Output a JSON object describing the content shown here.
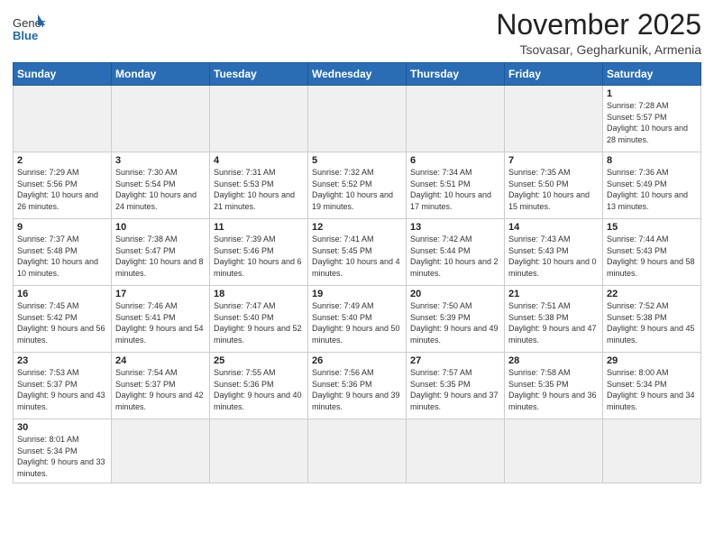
{
  "logo": {
    "general": "General",
    "blue": "Blue"
  },
  "header": {
    "month": "November 2025",
    "location": "Tsovasar, Gegharkunik, Armenia"
  },
  "weekdays": [
    "Sunday",
    "Monday",
    "Tuesday",
    "Wednesday",
    "Thursday",
    "Friday",
    "Saturday"
  ],
  "weeks": [
    [
      {
        "day": "",
        "info": ""
      },
      {
        "day": "",
        "info": ""
      },
      {
        "day": "",
        "info": ""
      },
      {
        "day": "",
        "info": ""
      },
      {
        "day": "",
        "info": ""
      },
      {
        "day": "",
        "info": ""
      },
      {
        "day": "1",
        "info": "Sunrise: 7:28 AM\nSunset: 5:57 PM\nDaylight: 10 hours and 28 minutes."
      }
    ],
    [
      {
        "day": "2",
        "info": "Sunrise: 7:29 AM\nSunset: 5:56 PM\nDaylight: 10 hours and 26 minutes."
      },
      {
        "day": "3",
        "info": "Sunrise: 7:30 AM\nSunset: 5:54 PM\nDaylight: 10 hours and 24 minutes."
      },
      {
        "day": "4",
        "info": "Sunrise: 7:31 AM\nSunset: 5:53 PM\nDaylight: 10 hours and 21 minutes."
      },
      {
        "day": "5",
        "info": "Sunrise: 7:32 AM\nSunset: 5:52 PM\nDaylight: 10 hours and 19 minutes."
      },
      {
        "day": "6",
        "info": "Sunrise: 7:34 AM\nSunset: 5:51 PM\nDaylight: 10 hours and 17 minutes."
      },
      {
        "day": "7",
        "info": "Sunrise: 7:35 AM\nSunset: 5:50 PM\nDaylight: 10 hours and 15 minutes."
      },
      {
        "day": "8",
        "info": "Sunrise: 7:36 AM\nSunset: 5:49 PM\nDaylight: 10 hours and 13 minutes."
      }
    ],
    [
      {
        "day": "9",
        "info": "Sunrise: 7:37 AM\nSunset: 5:48 PM\nDaylight: 10 hours and 10 minutes."
      },
      {
        "day": "10",
        "info": "Sunrise: 7:38 AM\nSunset: 5:47 PM\nDaylight: 10 hours and 8 minutes."
      },
      {
        "day": "11",
        "info": "Sunrise: 7:39 AM\nSunset: 5:46 PM\nDaylight: 10 hours and 6 minutes."
      },
      {
        "day": "12",
        "info": "Sunrise: 7:41 AM\nSunset: 5:45 PM\nDaylight: 10 hours and 4 minutes."
      },
      {
        "day": "13",
        "info": "Sunrise: 7:42 AM\nSunset: 5:44 PM\nDaylight: 10 hours and 2 minutes."
      },
      {
        "day": "14",
        "info": "Sunrise: 7:43 AM\nSunset: 5:43 PM\nDaylight: 10 hours and 0 minutes."
      },
      {
        "day": "15",
        "info": "Sunrise: 7:44 AM\nSunset: 5:43 PM\nDaylight: 9 hours and 58 minutes."
      }
    ],
    [
      {
        "day": "16",
        "info": "Sunrise: 7:45 AM\nSunset: 5:42 PM\nDaylight: 9 hours and 56 minutes."
      },
      {
        "day": "17",
        "info": "Sunrise: 7:46 AM\nSunset: 5:41 PM\nDaylight: 9 hours and 54 minutes."
      },
      {
        "day": "18",
        "info": "Sunrise: 7:47 AM\nSunset: 5:40 PM\nDaylight: 9 hours and 52 minutes."
      },
      {
        "day": "19",
        "info": "Sunrise: 7:49 AM\nSunset: 5:40 PM\nDaylight: 9 hours and 50 minutes."
      },
      {
        "day": "20",
        "info": "Sunrise: 7:50 AM\nSunset: 5:39 PM\nDaylight: 9 hours and 49 minutes."
      },
      {
        "day": "21",
        "info": "Sunrise: 7:51 AM\nSunset: 5:38 PM\nDaylight: 9 hours and 47 minutes."
      },
      {
        "day": "22",
        "info": "Sunrise: 7:52 AM\nSunset: 5:38 PM\nDaylight: 9 hours and 45 minutes."
      }
    ],
    [
      {
        "day": "23",
        "info": "Sunrise: 7:53 AM\nSunset: 5:37 PM\nDaylight: 9 hours and 43 minutes."
      },
      {
        "day": "24",
        "info": "Sunrise: 7:54 AM\nSunset: 5:37 PM\nDaylight: 9 hours and 42 minutes."
      },
      {
        "day": "25",
        "info": "Sunrise: 7:55 AM\nSunset: 5:36 PM\nDaylight: 9 hours and 40 minutes."
      },
      {
        "day": "26",
        "info": "Sunrise: 7:56 AM\nSunset: 5:36 PM\nDaylight: 9 hours and 39 minutes."
      },
      {
        "day": "27",
        "info": "Sunrise: 7:57 AM\nSunset: 5:35 PM\nDaylight: 9 hours and 37 minutes."
      },
      {
        "day": "28",
        "info": "Sunrise: 7:58 AM\nSunset: 5:35 PM\nDaylight: 9 hours and 36 minutes."
      },
      {
        "day": "29",
        "info": "Sunrise: 8:00 AM\nSunset: 5:34 PM\nDaylight: 9 hours and 34 minutes."
      }
    ],
    [
      {
        "day": "30",
        "info": "Sunrise: 8:01 AM\nSunset: 5:34 PM\nDaylight: 9 hours and 33 minutes."
      },
      {
        "day": "",
        "info": ""
      },
      {
        "day": "",
        "info": ""
      },
      {
        "day": "",
        "info": ""
      },
      {
        "day": "",
        "info": ""
      },
      {
        "day": "",
        "info": ""
      },
      {
        "day": "",
        "info": ""
      }
    ]
  ]
}
